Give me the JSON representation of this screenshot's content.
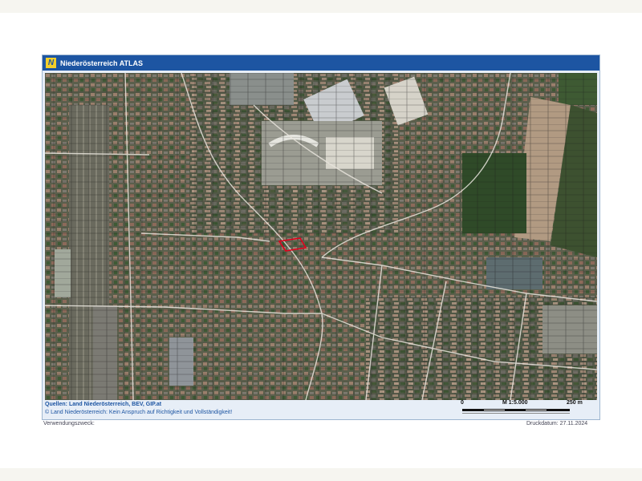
{
  "header": {
    "title": "Niederösterreich ATLAS",
    "logo_letter": "N",
    "logo_color": "#f3cf2a",
    "bar_color": "#1d55a2"
  },
  "map": {
    "kind": "aerial-imagery-with-cadastral-parcels",
    "highlight_color": "#e0001b"
  },
  "footer": {
    "sources": "Quellen: Land Niederösterreich, BEV, GIP.at",
    "disclaimer": "© Land Niederösterreich: Kein Anspruch auf Richtigkeit und Vollständigkeit!",
    "purpose_label": "Verwendungszweck:",
    "print_date": "Druckdatum: 27.11.2024"
  },
  "scale_bar": {
    "start_label": "0",
    "ratio_label": "M 1:5.000",
    "end_label": "250 m"
  }
}
